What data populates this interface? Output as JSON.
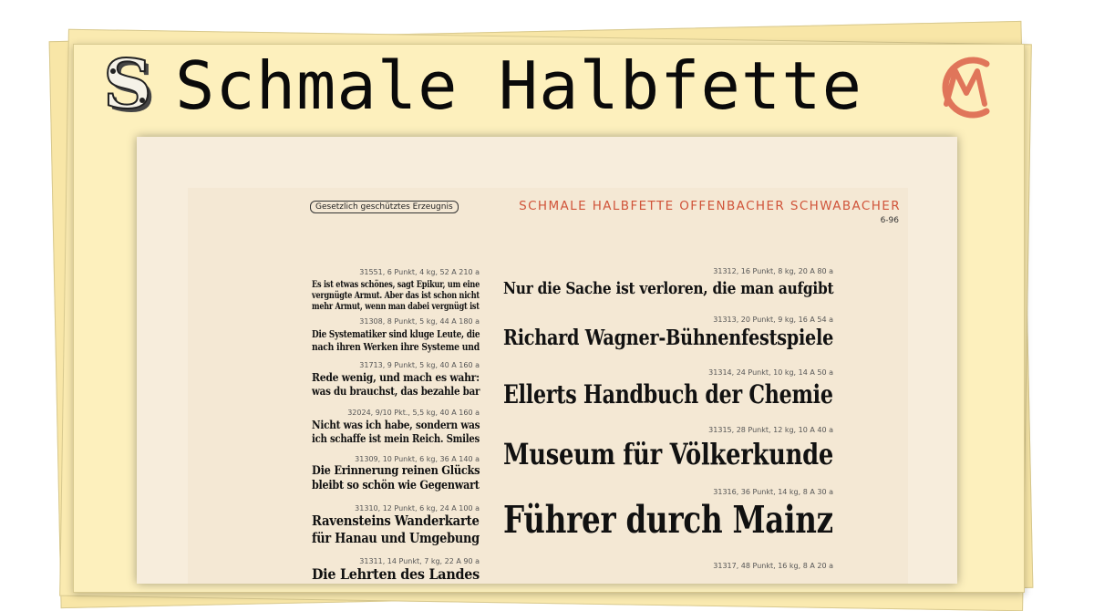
{
  "header": {
    "title": "Schmale Halbfette",
    "left_logo_icon": "ornamental-s-initial-icon",
    "right_logo_icon": "cm-monogram-icon",
    "right_logo_color": "#e0755a"
  },
  "specimen": {
    "tag": "Gesetzlich geschütztes Erzeugnis",
    "title": "SCHMALE HALBFETTE OFFENBACHER SCHWABACHER",
    "title_color": "#d0543a",
    "sheet_number": "6-96",
    "left_samples": [
      {
        "meta": "31551, 6 Punkt, 4 kg, 52 A 210 a",
        "lines": [
          "Es ist etwas schönes, sagt Epikur, um eine",
          "vergnügte Armut. Aber das ist schon nicht",
          "mehr Armut, wenn man dabei vergnügt ist"
        ]
      },
      {
        "meta": "31308, 8 Punkt, 5 kg, 44 A 180 a",
        "lines": [
          "Die Systematiker sind kluge Leute, die",
          "nach ihren Werken ihre Systeme und"
        ]
      },
      {
        "meta": "31713, 9 Punkt, 5 kg, 40 A 160 a",
        "lines": [
          "Rede wenig, und mach es wahr:",
          "was du brauchst, das bezahle bar"
        ]
      },
      {
        "meta": "32024, 9/10 Pkt., 5,5 kg, 40 A 160 a",
        "lines": [
          "Nicht was ich habe, sondern was",
          "ich schaffe ist mein Reich. Smiles"
        ]
      },
      {
        "meta": "31309, 10 Punkt, 6 kg, 36 A 140 a",
        "lines": [
          "Die Erinnerung reinen Glücks",
          "bleibt so schön wie Gegenwart"
        ]
      },
      {
        "meta": "31310, 12 Punkt, 6 kg, 24 A 100 a",
        "lines": [
          "Ravensteins Wanderkarte",
          "für Hanau und Umgebung"
        ]
      },
      {
        "meta": "31311, 14 Punkt, 7 kg, 22 A 90 a",
        "lines": [
          "Die Lehrten des Landes"
        ]
      }
    ],
    "right_samples": [
      {
        "meta": "31312, 16 Punkt, 8 kg, 20 A 80 a",
        "line": "Nur die Sache ist verloren, die man aufgibt"
      },
      {
        "meta": "31313, 20 Punkt, 9 kg, 16 A 54 a",
        "line": "Richard Wagner-Bühnenfestspiele"
      },
      {
        "meta": "31314, 24 Punkt, 10 kg, 14 A 50 a",
        "line": "Ellerts Handbuch der Chemie"
      },
      {
        "meta": "31315, 28 Punkt, 12 kg, 10 A 40 a",
        "line": "Museum für Völkerkunde"
      },
      {
        "meta": "31316, 36 Punkt, 14 kg, 8 A 30 a",
        "line": "Führer durch Mainz"
      },
      {
        "meta": "31317, 48 Punkt, 16 kg, 8 A 20 a",
        "line": ""
      }
    ]
  }
}
